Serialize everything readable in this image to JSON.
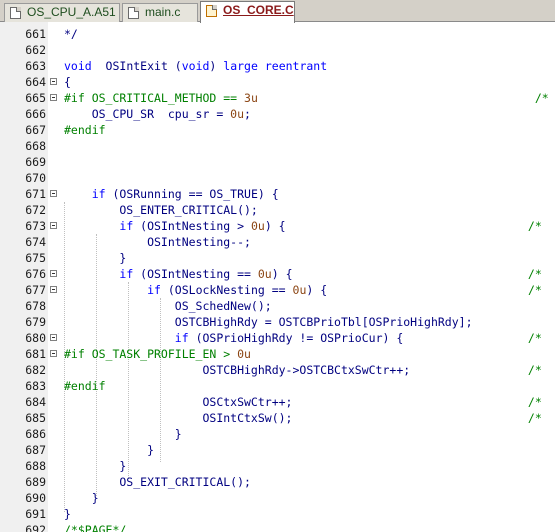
{
  "tabs": [
    {
      "label": "OS_CPU_A.A51",
      "active": false
    },
    {
      "label": "main.c",
      "active": false
    },
    {
      "label": "OS_CORE.C",
      "active": true
    }
  ],
  "lines": [
    {
      "n": "661",
      "text": "*/"
    },
    {
      "n": "662",
      "text": ""
    },
    {
      "n": "663",
      "text": "void  OSIntExit (void) large reentrant"
    },
    {
      "n": "664",
      "text": "{"
    },
    {
      "n": "665",
      "text": "#if OS_CRITICAL_METHOD == 3u                                        /*"
    },
    {
      "n": "666",
      "text": "    OS_CPU_SR  cpu_sr = 0u;"
    },
    {
      "n": "667",
      "text": "#endif"
    },
    {
      "n": "668",
      "text": ""
    },
    {
      "n": "669",
      "text": ""
    },
    {
      "n": "670",
      "text": ""
    },
    {
      "n": "671",
      "text": "    if (OSRunning == OS_TRUE) {"
    },
    {
      "n": "672",
      "text": "        OS_ENTER_CRITICAL();"
    },
    {
      "n": "673",
      "text": "        if (OSIntNesting > 0u) {                                   /*"
    },
    {
      "n": "674",
      "text": "            OSIntNesting--;"
    },
    {
      "n": "675",
      "text": "        }"
    },
    {
      "n": "676",
      "text": "        if (OSIntNesting == 0u) {                                  /*"
    },
    {
      "n": "677",
      "text": "            if (OSLockNesting == 0u) {                             /*"
    },
    {
      "n": "678",
      "text": "                OS_SchedNew();"
    },
    {
      "n": "679",
      "text": "                OSTCBHighRdy = OSTCBPrioTbl[OSPrioHighRdy];"
    },
    {
      "n": "680",
      "text": "                if (OSPrioHighRdy != OSPrioCur) {                  /*"
    },
    {
      "n": "681",
      "text": "#if OS_TASK_PROFILE_EN > 0u"
    },
    {
      "n": "682",
      "text": "                    OSTCBHighRdy->OSTCBCtxSwCtr++;                 /*"
    },
    {
      "n": "683",
      "text": "#endif"
    },
    {
      "n": "684",
      "text": "                    OSCtxSwCtr++;                                  /*"
    },
    {
      "n": "685",
      "text": "                    OSIntCtxSw();                                  /*"
    },
    {
      "n": "686",
      "text": "                }"
    },
    {
      "n": "687",
      "text": "            }"
    },
    {
      "n": "688",
      "text": "        }"
    },
    {
      "n": "689",
      "text": "        OS_EXIT_CRITICAL();"
    },
    {
      "n": "690",
      "text": "    }"
    },
    {
      "n": "691",
      "text": "}"
    },
    {
      "n": "692",
      "text": "/*$PAGE*/"
    }
  ]
}
